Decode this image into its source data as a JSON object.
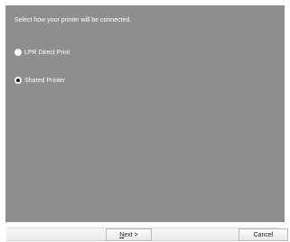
{
  "panel": {
    "prompt": "Select how your printer will be connected."
  },
  "options": [
    {
      "label": "LPR Direct Print",
      "selected": false
    },
    {
      "label": "Shared Printer",
      "selected": true
    }
  ],
  "footer": {
    "next_mnemonic": "N",
    "next_rest": "ext >",
    "cancel_label": "Cancel"
  },
  "colors": {
    "panel_background": "#8e8e8f",
    "text": "#ffffff"
  }
}
